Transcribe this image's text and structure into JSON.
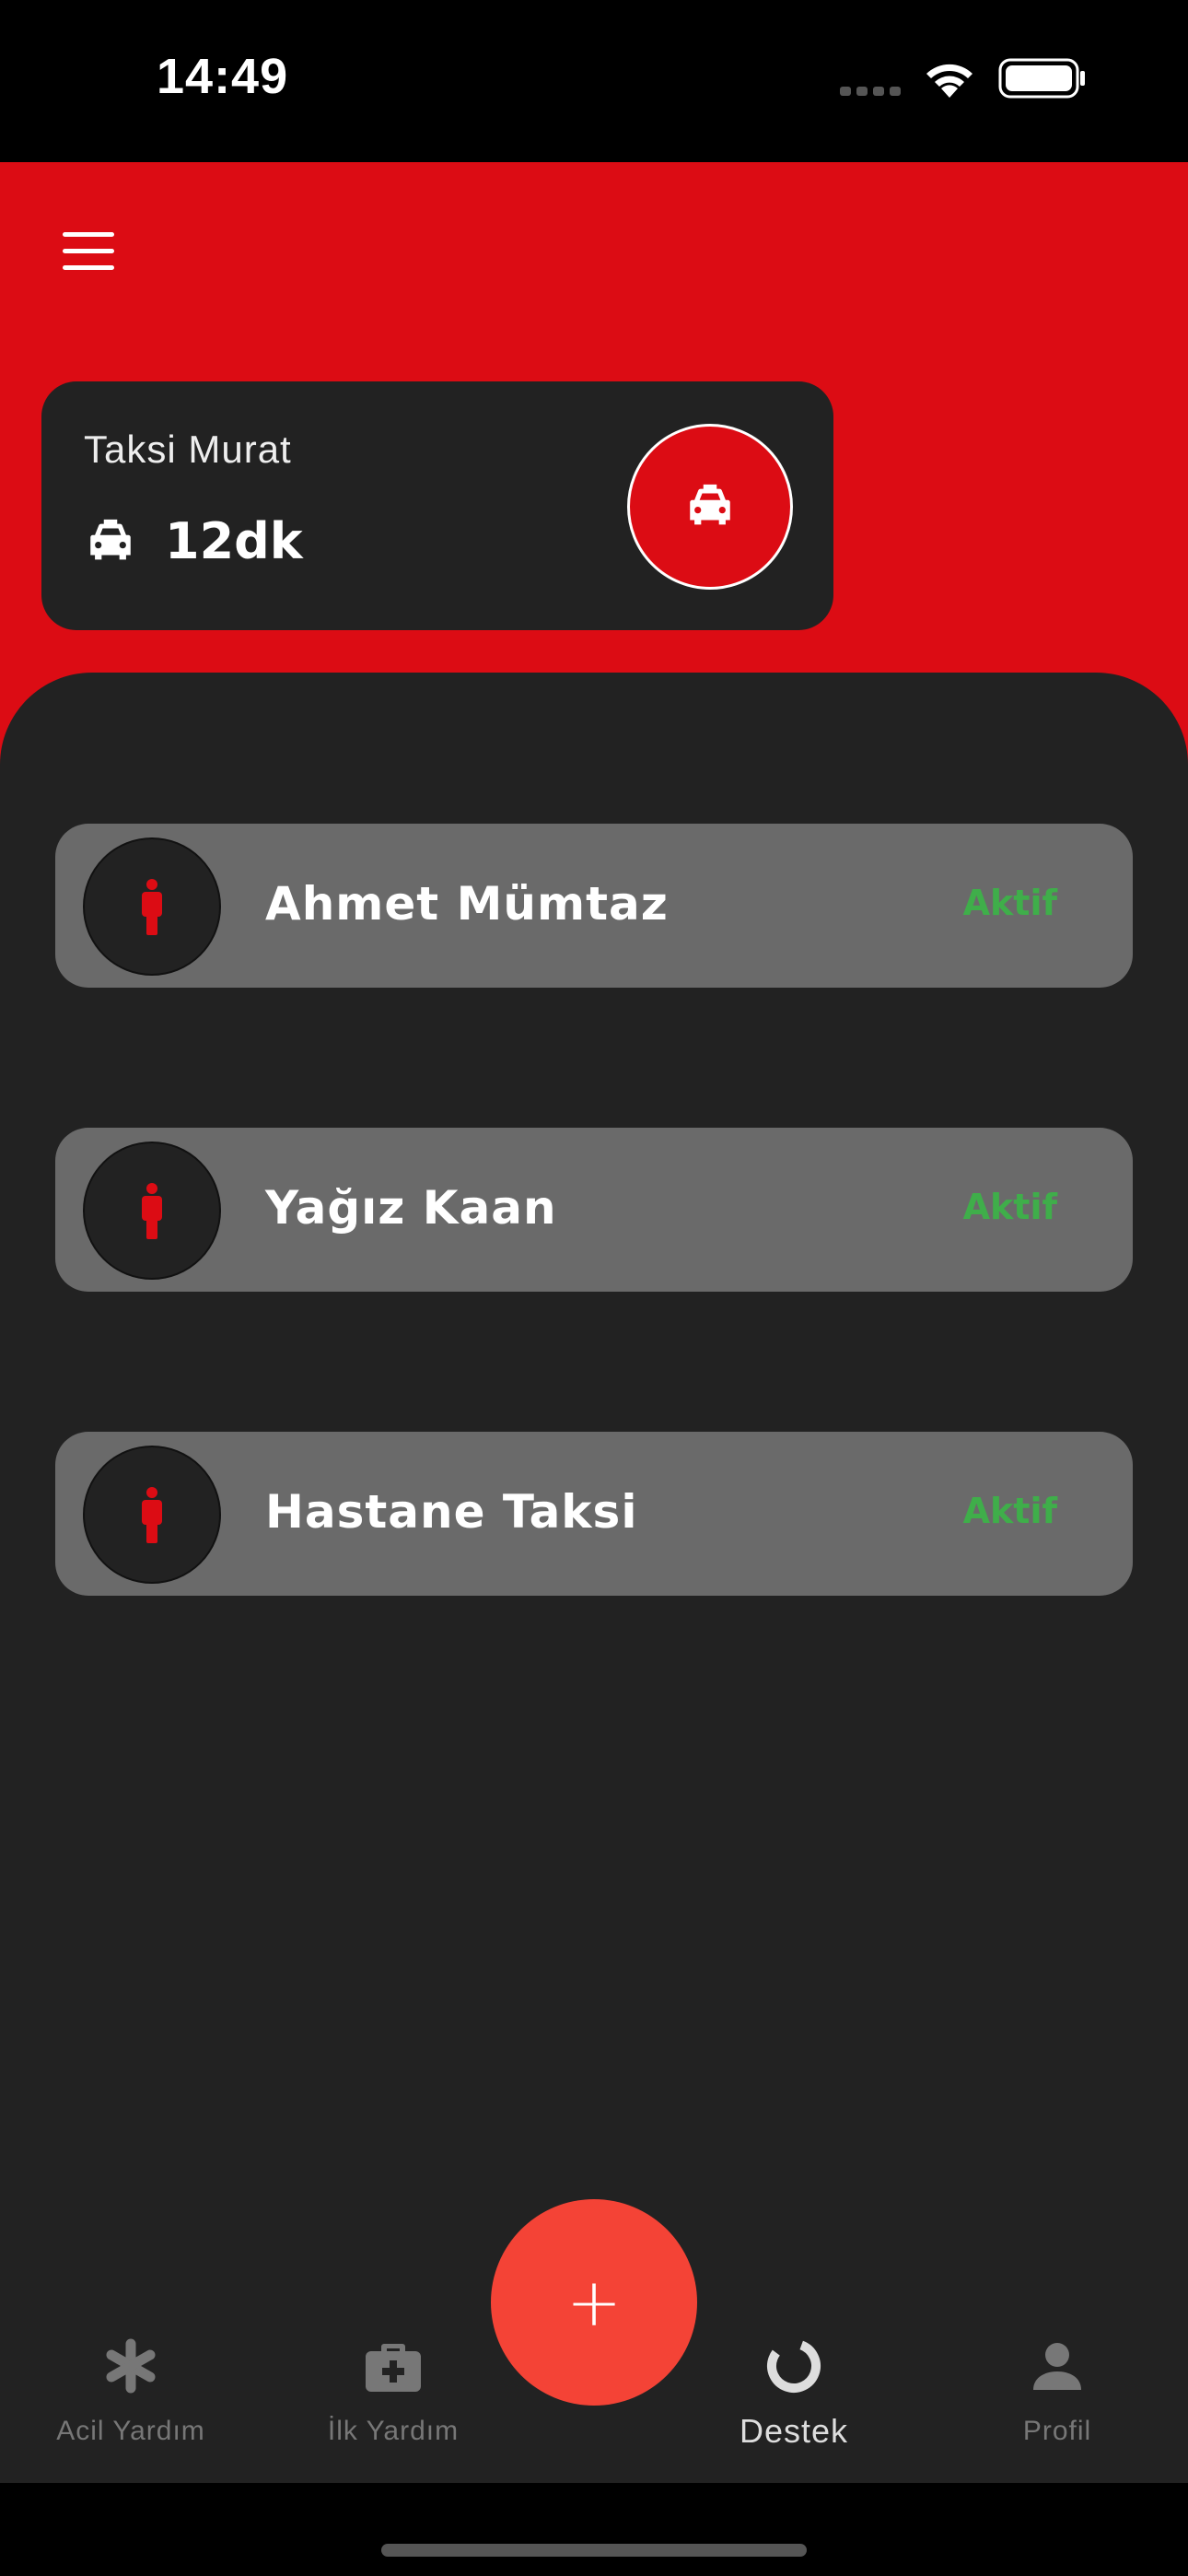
{
  "status_bar": {
    "time": "14:49"
  },
  "driver_card": {
    "name": "Taksi Murat",
    "eta": "12dk"
  },
  "contacts": [
    {
      "name": "Ahmet Mümtaz",
      "status": "Aktif"
    },
    {
      "name": "Yağız Kaan",
      "status": "Aktif"
    },
    {
      "name": "Hastane Taksi",
      "status": "Aktif"
    }
  ],
  "fab": {
    "label": "+"
  },
  "bottom_nav": [
    {
      "label": "Acil Yardım",
      "icon": "asterisk-icon",
      "active": false
    },
    {
      "label": "İlk Yardım",
      "icon": "first-aid-kit-icon",
      "active": false
    },
    {
      "label": "Destek",
      "icon": "loading-ring-icon",
      "active": true
    },
    {
      "label": "Profil",
      "icon": "person-icon",
      "active": false
    }
  ],
  "colors": {
    "brand_red": "#dc0c14",
    "fab_red": "#f44336",
    "panel": "#222222",
    "row": "#6a6a6a",
    "status_green": "#3fae4a"
  }
}
